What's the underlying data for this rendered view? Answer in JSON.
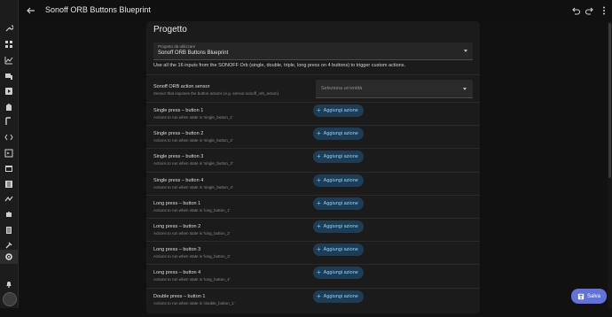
{
  "header": {
    "title": "Sonoff ORB Buttons Blueprint"
  },
  "card": {
    "title": "Progetto",
    "blueprint": {
      "label": "Progetto da utilizzare",
      "value": "Sonoff ORB Buttons Blueprint"
    },
    "description": "Use all the 16 inputs from the SONOFF Orb (single, double, triple, long press on 4 buttons) to trigger custom actions.",
    "sensor": {
      "label": "Sonoff ORB action sensor",
      "sub": "Sensor that exposes the button actions (e.g. sensor.sonoff_orb_action).",
      "placeholder": "Seleziona un'entità"
    },
    "add_label": "Aggiungi azione",
    "rows": [
      {
        "label": "Single press – button 1",
        "sub": "Actions to run when state is 'single_button_1'"
      },
      {
        "label": "Single press – button 2",
        "sub": "Actions to run when state is 'single_button_2'"
      },
      {
        "label": "Single press – button 3",
        "sub": "Actions to run when state is 'single_button_3'"
      },
      {
        "label": "Single press – button 4",
        "sub": "Actions to run when state is 'single_button_4'"
      },
      {
        "label": "Long press – button 1",
        "sub": "Actions to run when state is 'long_button_1'"
      },
      {
        "label": "Long press – button 2",
        "sub": "Actions to run when state is 'long_button_2'"
      },
      {
        "label": "Long press – button 3",
        "sub": "Actions to run when state is 'long_button_3'"
      },
      {
        "label": "Long press – button 4",
        "sub": "Actions to run when state is 'long_button_4'"
      },
      {
        "label": "Double press – button 1",
        "sub": "Actions to run when state is 'double_button_1'"
      }
    ]
  },
  "save_label": "Salva",
  "sidebar": {
    "icons": [
      "wrench-icon",
      "grid-icon",
      "chart-icon",
      "devices-icon",
      "media-icon",
      "building-icon",
      "tag-icon",
      "code-icon",
      "energy-icon",
      "terminal-icon",
      "calendar-icon",
      "list-icon",
      "map-icon",
      "puzzle-icon",
      "server-icon",
      "hammer-icon",
      "gear-icon",
      "bell-icon"
    ]
  },
  "colors": {
    "accent": "#6372d6",
    "action_text": "#8fd3ff",
    "action_bg": "#1e3d55",
    "background": "#111111",
    "card": "#1b1b1b"
  }
}
